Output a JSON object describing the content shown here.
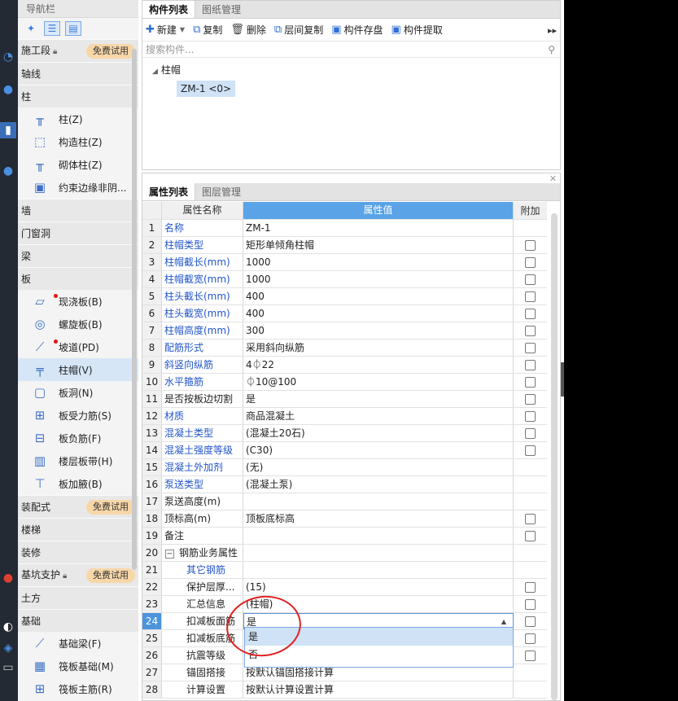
{
  "nav": {
    "title": "导航栏",
    "categories": [
      {
        "label": "施工段",
        "badge": "免费试用",
        "lock": true
      },
      {
        "label": "轴线"
      },
      {
        "label": "柱"
      },
      {
        "label": "墙"
      },
      {
        "label": "门窗洞"
      },
      {
        "label": "梁"
      },
      {
        "label": "板"
      },
      {
        "label": "装配式",
        "badge": "免费试用"
      },
      {
        "label": "楼梯"
      },
      {
        "label": "装修"
      },
      {
        "label": "基坑支护",
        "badge": "免费试用",
        "lock": true
      },
      {
        "label": "土方"
      },
      {
        "label": "基础"
      }
    ],
    "column_items": [
      "柱(Z)",
      "构造柱(Z)",
      "砌体柱(Z)",
      "约束边缘非阴..."
    ],
    "slab_items": [
      "现浇板(B)",
      "螺旋板(B)",
      "坡道(PD)",
      "柱帽(V)",
      "板洞(N)",
      "板受力筋(S)",
      "板负筋(F)",
      "楼层板带(H)",
      "板加腋(B)"
    ],
    "foundation_items": [
      "基础梁(F)",
      "筏板基础(M)",
      "筏板主筋(R)"
    ]
  },
  "comp": {
    "tabs": [
      "构件列表",
      "图纸管理"
    ],
    "toolbar": {
      "new": "新建",
      "copy": "复制",
      "delete": "删除",
      "floor_copy": "层间复制",
      "save": "构件存盘",
      "extract": "构件提取"
    },
    "search_placeholder": "搜索构件...",
    "tree_root": "柱帽",
    "tree_leaf": "ZM-1 <0>"
  },
  "prop": {
    "tabs": [
      "属性列表",
      "图层管理"
    ],
    "headers": {
      "name": "属性名称",
      "value": "属性值",
      "extra": "附加"
    },
    "rows": [
      {
        "n": "1",
        "name": "名称",
        "value": "ZM-1",
        "blue": true,
        "cb": false
      },
      {
        "n": "2",
        "name": "柱帽类型",
        "value": "矩形单倾角柱帽",
        "blue": true,
        "cb": true
      },
      {
        "n": "3",
        "name": "柱帽截长(mm)",
        "value": "1000",
        "blue": true,
        "cb": true
      },
      {
        "n": "4",
        "name": "柱帽截宽(mm)",
        "value": "1000",
        "blue": true,
        "cb": true
      },
      {
        "n": "5",
        "name": "柱头截长(mm)",
        "value": "400",
        "blue": true,
        "cb": true
      },
      {
        "n": "6",
        "name": "柱头截宽(mm)",
        "value": "400",
        "blue": true,
        "cb": true
      },
      {
        "n": "7",
        "name": "柱帽高度(mm)",
        "value": "300",
        "blue": true,
        "cb": true
      },
      {
        "n": "8",
        "name": "配筋形式",
        "value": "采用斜向纵筋",
        "blue": true,
        "cb": true
      },
      {
        "n": "9",
        "name": "斜竖向纵筋",
        "value": "4⏀22",
        "blue": true,
        "cb": true
      },
      {
        "n": "10",
        "name": "水平箍筋",
        "value": "⏀10@100",
        "blue": true,
        "cb": true
      },
      {
        "n": "11",
        "name": "是否按板边切割",
        "value": "是",
        "blue": false,
        "cb": true
      },
      {
        "n": "12",
        "name": "材质",
        "value": "商品混凝土",
        "blue": true,
        "cb": true
      },
      {
        "n": "13",
        "name": "混凝土类型",
        "value": "(混凝土20石)",
        "blue": true,
        "cb": true
      },
      {
        "n": "14",
        "name": "混凝土强度等级",
        "value": "(C30)",
        "blue": true,
        "cb": true
      },
      {
        "n": "15",
        "name": "混凝土外加剂",
        "value": "(无)",
        "blue": true,
        "cb": false
      },
      {
        "n": "16",
        "name": "泵送类型",
        "value": "(混凝土泵)",
        "blue": true,
        "cb": false
      },
      {
        "n": "17",
        "name": "泵送高度(m)",
        "value": "",
        "blue": false,
        "cb": false
      },
      {
        "n": "18",
        "name": "顶标高(m)",
        "value": "顶板底标高",
        "blue": false,
        "cb": true
      },
      {
        "n": "19",
        "name": "备注",
        "value": "",
        "blue": false,
        "cb": true
      },
      {
        "n": "20",
        "name": "钢筋业务属性",
        "value": "",
        "blue": false,
        "cb": false,
        "group": true
      },
      {
        "n": "21",
        "name": "其它钢筋",
        "value": "",
        "blue": true,
        "cb": false,
        "indent": true
      },
      {
        "n": "22",
        "name": "保护层厚...",
        "value": "(15)",
        "blue": false,
        "cb": true,
        "indent": true
      },
      {
        "n": "23",
        "name": "汇总信息",
        "value": "(柱帽)",
        "blue": false,
        "cb": true,
        "indent": true
      },
      {
        "n": "24",
        "name": "扣减板面筋",
        "value": "是",
        "blue": false,
        "cb": true,
        "indent": true,
        "selected": true
      },
      {
        "n": "25",
        "name": "扣减板底筋",
        "value": "",
        "blue": false,
        "cb": true,
        "indent": true
      },
      {
        "n": "26",
        "name": "抗震等级",
        "value": "",
        "blue": false,
        "cb": true,
        "indent": true
      },
      {
        "n": "27",
        "name": "锚固搭接",
        "value": "按默认锚固搭接计算",
        "blue": false,
        "cb": false,
        "indent": true
      },
      {
        "n": "28",
        "name": "计算设置",
        "value": "按默认计算设置计算",
        "blue": false,
        "cb": false,
        "indent": true
      }
    ],
    "dropdown_options": [
      "是",
      "否"
    ]
  }
}
